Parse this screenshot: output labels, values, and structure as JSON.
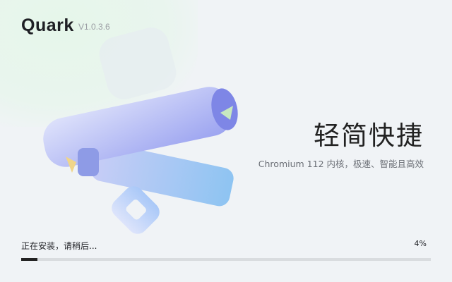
{
  "app": {
    "name": "Quark",
    "version": "V1.0.3.6"
  },
  "hero": {
    "headline": "轻简快捷",
    "subtitle": "Chromium 112 内核，极速、智能且高效"
  },
  "install": {
    "status": "正在安装，请稍后...",
    "percent_label": "4%",
    "progress": 0.04
  },
  "colors": {
    "progress_fill": "#222222",
    "progress_track": "#d9dcdf"
  }
}
